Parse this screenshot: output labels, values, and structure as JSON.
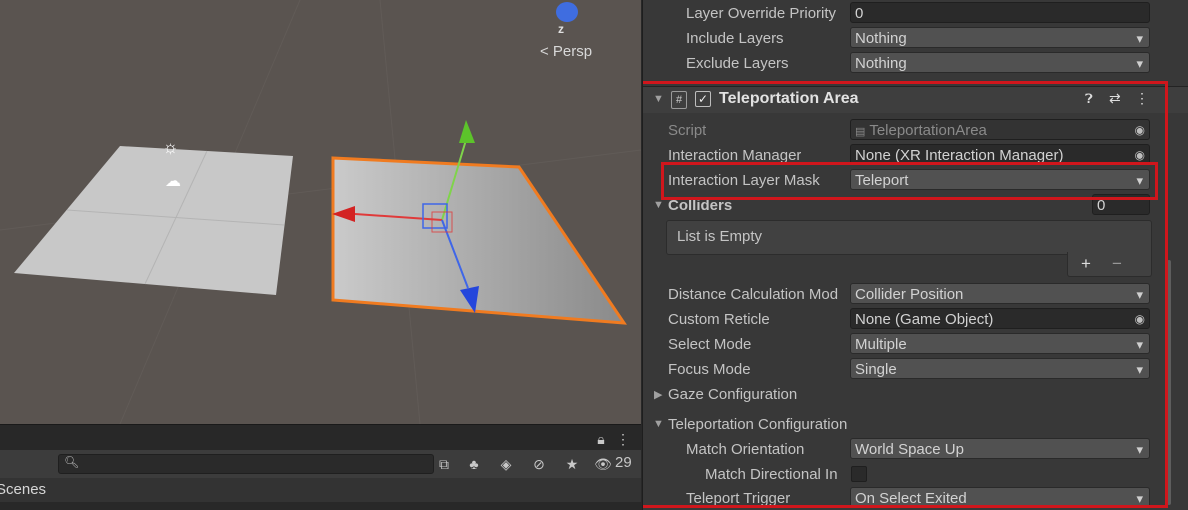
{
  "scene": {
    "axis_label": "z",
    "projection_label": "< Persp"
  },
  "bottom_panel": {
    "hidden_count": "29",
    "scenes_label": "Scenes"
  },
  "inspector": {
    "top_rows": [
      {
        "label": "Layer Override Priority",
        "value": "0"
      },
      {
        "label": "Include Layers",
        "value": "Nothing"
      },
      {
        "label": "Exclude Layers",
        "value": "Nothing"
      }
    ],
    "component": {
      "title": "Teleportation Area",
      "enabled": true,
      "script_label": "Script",
      "script_value": "TeleportationArea",
      "interaction_manager_label": "Interaction Manager",
      "interaction_manager_value": "None (XR Interaction Manager)",
      "layer_mask_label": "Interaction Layer Mask",
      "layer_mask_value": "Teleport",
      "colliders_label": "Colliders",
      "colliders_count": "0",
      "list_empty": "List is Empty",
      "add": "+",
      "remove": "−",
      "distance_label": "Distance Calculation Mod",
      "distance_value": "Collider Position",
      "reticle_label": "Custom Reticle",
      "reticle_value": "None (Game Object)",
      "select_label": "Select Mode",
      "select_value": "Multiple",
      "focus_label": "Focus Mode",
      "focus_value": "Single",
      "gaze_label": "Gaze Configuration",
      "teleport_config_label": "Teleportation Configuration",
      "orientation_label": "Match Orientation",
      "orientation_value": "World Space Up",
      "directional_label": "Match Directional In",
      "trigger_label": "Teleport Trigger",
      "trigger_value": "On Select Exited"
    }
  }
}
